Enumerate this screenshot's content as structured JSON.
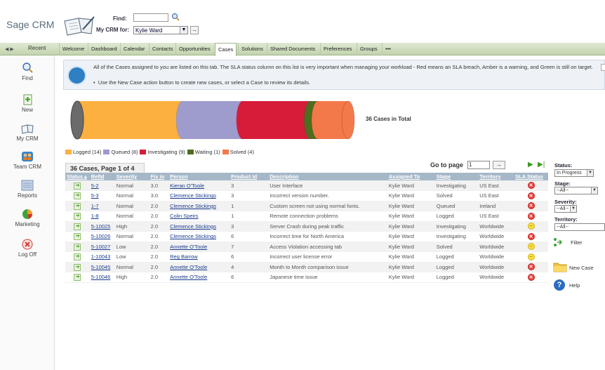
{
  "app": {
    "logo_text": "Sage CRM"
  },
  "header": {
    "find_label": "Find:",
    "mycrm_label": "My CRM for:",
    "mycrm_value": "Kylie Ward"
  },
  "nav": {
    "recent_label": "Recent",
    "tabs": [
      "Welcome",
      "Dashboard",
      "Calendar",
      "Contacts",
      "Opportunities",
      "Cases",
      "Solutions",
      "Shared Documents",
      "Preferences",
      "Groups",
      "•••"
    ],
    "active_tab": "Cases"
  },
  "sidebar": {
    "items": [
      {
        "label": "Find",
        "icon": "magnifier-icon"
      },
      {
        "label": "New",
        "icon": "new-document-icon"
      },
      {
        "label": "My CRM",
        "icon": "notebook-icon"
      },
      {
        "label": "Team CRM",
        "icon": "team-icon"
      },
      {
        "label": "Reports",
        "icon": "report-icon"
      },
      {
        "label": "Marketing",
        "icon": "pie-chart-icon"
      },
      {
        "label": "Log Off",
        "icon": "logoff-icon"
      }
    ]
  },
  "info": {
    "text": "All of the Cases assigned to you are listed on this tab. The SLA status column on this list is very important when managing your workload - Red means an SLA breach, Amber is a warning, and Green is still on target.",
    "bullet": "Use the New Case action button to create new cases, or select a Case to review its details."
  },
  "chart_data": {
    "type": "bar",
    "orientation": "horizontal-stacked-cylinder",
    "categories": [
      "Logged",
      "Queued",
      "Investigating",
      "Waiting",
      "Solved"
    ],
    "values": [
      14,
      8,
      9,
      1,
      4
    ],
    "colors": [
      "#fbb040",
      "#9d9ccd",
      "#d71c3a",
      "#4f6d1e",
      "#f4794a"
    ],
    "total_label": "36 Cases in Total",
    "legend": [
      "Logged (14)",
      "Queued (8)",
      "Investigating (9)",
      "Waiting (1)",
      "Solved (4)"
    ],
    "legend_position": "bottom"
  },
  "list": {
    "title": "36 Cases, Page 1 of 4",
    "goto_label": "Go to page",
    "goto_value": "1",
    "columns": [
      "Status ▴",
      "RefId",
      "Severity",
      "Fix in",
      "Person",
      "Product Id",
      "Description",
      "Assigned To",
      "Stage",
      "Territory",
      "SLA Status"
    ],
    "rows": [
      {
        "refid": "5-2",
        "severity": "Normal",
        "fix": "3.0",
        "person": "Kieran O'Toole",
        "product": "3",
        "desc": "User Interface",
        "assigned": "Kylie Ward",
        "stage": "Investigating",
        "territory": "US East",
        "sla": "red"
      },
      {
        "refid": "5-3",
        "severity": "Normal",
        "fix": "3.0",
        "person": "Clemence Stickings",
        "product": "3",
        "desc": "Incorrect version number.",
        "assigned": "Kylie Ward",
        "stage": "Solved",
        "territory": "US East",
        "sla": "red"
      },
      {
        "refid": "1-7",
        "severity": "Normal",
        "fix": "2.0",
        "person": "Clemence Stickings",
        "product": "1",
        "desc": "Custom screen not using normal fonts.",
        "assigned": "Kylie Ward",
        "stage": "Queued",
        "territory": "Ireland",
        "sla": "red"
      },
      {
        "refid": "1-8",
        "severity": "Normal",
        "fix": "2.0",
        "person": "Colin Speirs",
        "product": "1",
        "desc": "Remote connection problems",
        "assigned": "Kylie Ward",
        "stage": "Logged",
        "territory": "US East",
        "sla": "red"
      },
      {
        "refid": "5-10025",
        "severity": "High",
        "fix": "2.0",
        "person": "Clemence Stickings",
        "product": "3",
        "desc": "Server Crash during peak traffic",
        "assigned": "Kylie Ward",
        "stage": "Investigating",
        "territory": "Worldwide",
        "sla": "amber"
      },
      {
        "refid": "5-10026",
        "severity": "Normal",
        "fix": "2.0",
        "person": "Clemence Stickings",
        "product": "6",
        "desc": "Incorrect time for North America",
        "assigned": "Kylie Ward",
        "stage": "Investigating",
        "territory": "Worldwide",
        "sla": "red"
      },
      {
        "refid": "5-10027",
        "severity": "Low",
        "fix": "2.0",
        "person": "Annette O'Toole",
        "product": "7",
        "desc": "Access Violation accessing tab",
        "assigned": "Kylie Ward",
        "stage": "Solved",
        "territory": "Worldwide",
        "sla": "amber"
      },
      {
        "refid": "1-10043",
        "severity": "Low",
        "fix": "2.0",
        "person": "Reg Barrow",
        "product": "6",
        "desc": "Incorrect user license error",
        "assigned": "Kylie Ward",
        "stage": "Logged",
        "territory": "Worldwide",
        "sla": "amber"
      },
      {
        "refid": "5-10045",
        "severity": "Normal",
        "fix": "2.0",
        "person": "Annette O'Toole",
        "product": "4",
        "desc": "Month to Month comparison issue",
        "assigned": "Kylie Ward",
        "stage": "Logged",
        "territory": "Worldwide",
        "sla": "red"
      },
      {
        "refid": "5-10046",
        "severity": "High",
        "fix": "2.0",
        "person": "Annette O'Toole",
        "product": "6",
        "desc": "Japanese time issue",
        "assigned": "Kylie Ward",
        "stage": "Logged",
        "territory": "Worldwide",
        "sla": "red"
      }
    ]
  },
  "filters": {
    "status_label": "Status:",
    "status_value": "In Progress",
    "stage_label": "Stage:",
    "stage_value": "--All--",
    "severity_label": "Severity:",
    "severity_value": "--All--",
    "territory_label": "Territory:",
    "territory_value": "--All--",
    "filter_label": "Filter",
    "new_case_label": "New Case",
    "help_label": "Help"
  }
}
